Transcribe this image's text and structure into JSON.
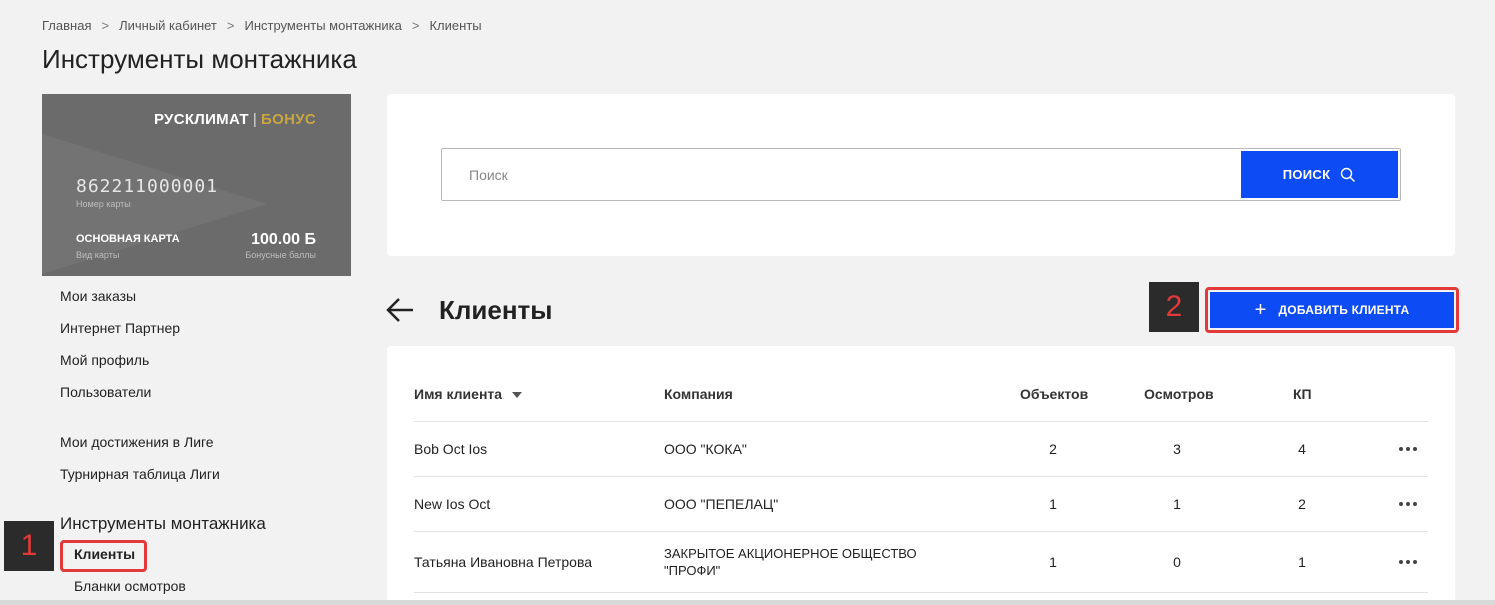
{
  "breadcrumb": [
    "Главная",
    "Личный кабинет",
    "Инструменты монтажника",
    "Клиенты"
  ],
  "breadcrumb_separator": ">",
  "page_title": "Инструменты монтажника",
  "bonus_card": {
    "brand_main": "РУСКЛИМАТ",
    "brand_sep": "|",
    "brand_accent": "БОНУС",
    "card_number": "862211000001",
    "card_number_label": "Номер карты",
    "card_type": "ОСНОВНАЯ КАРТА",
    "card_type_label": "Вид карты",
    "points": "100.00 Б",
    "points_label": "Бонусные баллы"
  },
  "sidebar": {
    "links": [
      "Мои заказы",
      "Интернет Партнер",
      "Мой профиль",
      "Пользователи",
      "Мои достижения в Лиге",
      "Турнирная таблица Лиги"
    ],
    "section_title": "Инструменты монтажника",
    "sub_items": [
      "Клиенты",
      "Бланки осмотров"
    ]
  },
  "markers": {
    "first": "1",
    "second": "2"
  },
  "search": {
    "placeholder": "Поиск",
    "button_label": "ПОИСК"
  },
  "clients": {
    "title": "Клиенты",
    "add_button_label": "ДОБАВИТЬ КЛИЕНТА",
    "columns": {
      "name": "Имя клиента",
      "company": "Компания",
      "objects": "Объектов",
      "inspections": "Осмотров",
      "kp": "КП"
    },
    "rows": [
      {
        "name": "Bob Oct Ios",
        "company": "ООО \"КОКА\"",
        "objects": "2",
        "inspections": "3",
        "kp": "4"
      },
      {
        "name": "New Ios Oct",
        "company": "ООО \"ПЕПЕЛАЦ\"",
        "objects": "1",
        "inspections": "1",
        "kp": "2"
      },
      {
        "name": "Татьяна Ивановна Петрова",
        "company_line1": "ЗАКРЫТОЕ АКЦИОНЕРНОЕ ОБЩЕСТВО",
        "company_line2": "\"ПРОФИ\"",
        "objects": "1",
        "inspections": "0",
        "kp": "1"
      }
    ]
  },
  "colors": {
    "accent": "#0d4cf5",
    "highlight": "#e23a3a",
    "card_bg": "#6b6b6b",
    "brand_gold": "#c9a640"
  },
  "icons": {
    "search": "search-icon",
    "back": "arrow-left-icon",
    "add": "plus-icon",
    "row_menu": "more-horizontal-icon",
    "sort": "caret-down-icon"
  }
}
